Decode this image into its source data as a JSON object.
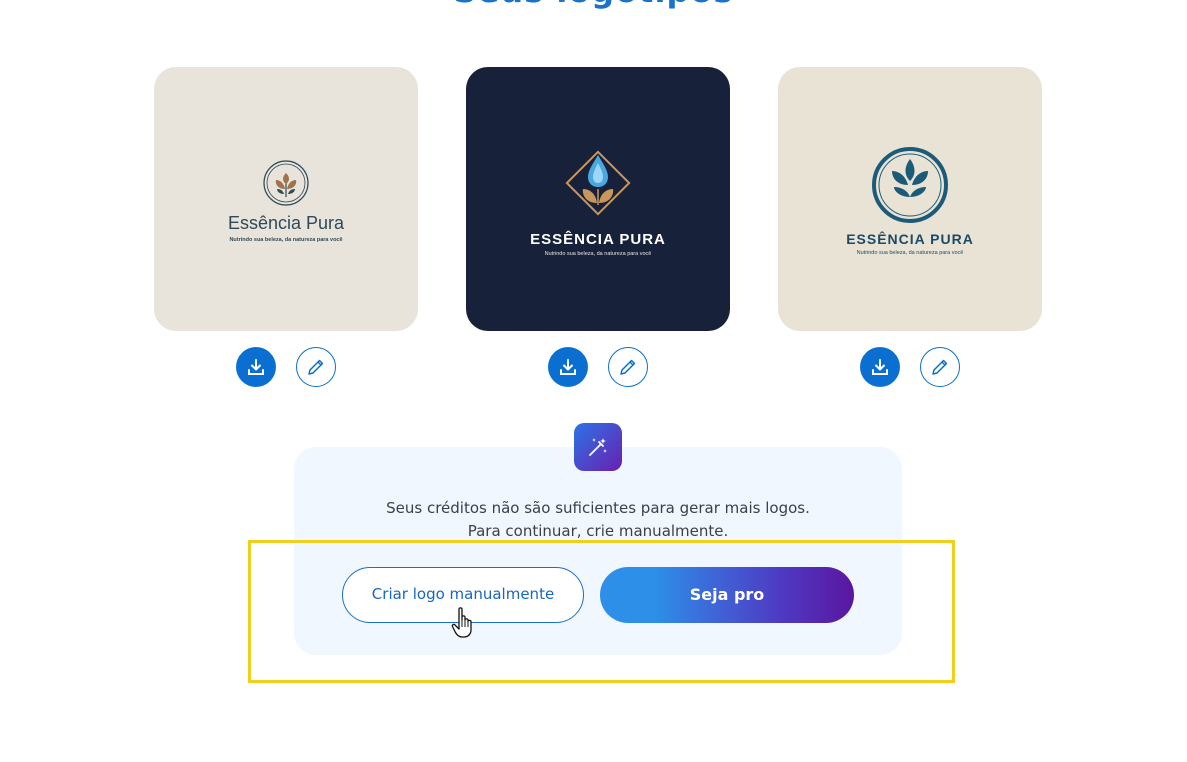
{
  "header": {
    "title": "Seus logotipos"
  },
  "logos": [
    {
      "brand": "Essência Pura",
      "tagline": "Nutrindo sua beleza, da natureza para você",
      "bg": "#e8e3db",
      "text_color": "#2f4a57",
      "accent": "#a0724e"
    },
    {
      "brand": "ESSÊNCIA PURA",
      "tagline": "Nutrindo sua beleza, da natureza para você",
      "bg": "#18213a",
      "text_color": "#ffffff",
      "accent": "#c9975e"
    },
    {
      "brand": "ESSÊNCIA PURA",
      "tagline": "Nutrindo sua beleza, da natureza para você",
      "bg": "#e9e3d6",
      "text_color": "#1c4a66",
      "accent": "#1c5b78"
    }
  ],
  "actions": {
    "download_icon": "download-icon",
    "edit_icon": "pencil-icon"
  },
  "credits": {
    "line1": "Seus créditos não são suficientes para gerar mais logos.",
    "line2": "Para continuar, crie manualmente.",
    "icon": "magic-wand-icon"
  },
  "buttons": {
    "manual_label": "Criar logo manualmente",
    "pro_label": "Seja pro"
  },
  "colors": {
    "primary": "#0a6fd1",
    "highlight": "#f2cf1c",
    "panel": "#f1f7fe"
  }
}
